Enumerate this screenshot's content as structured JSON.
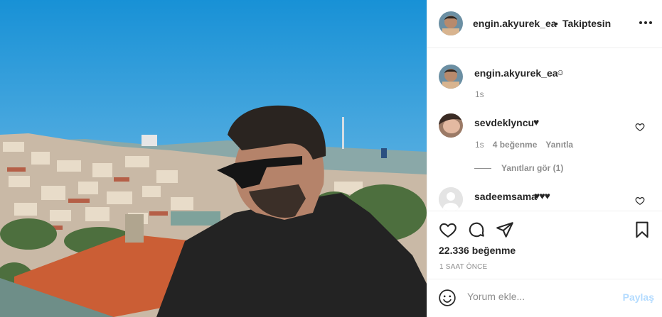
{
  "photo": {
    "alt_icon": "photo"
  },
  "header": {
    "username": "engin.akyurek_ea",
    "separator": "•",
    "follow_label": "Takiptesin",
    "more_icon": "more-horizontal-icon"
  },
  "caption": {
    "username": "engin.akyurek_ea",
    "text": "☺",
    "time": "1s"
  },
  "comments": [
    {
      "username": "sevdeklyncu",
      "text": "♥",
      "time": "1s",
      "likes": "4 beğenme",
      "reply_label": "Yanıtla",
      "view_replies": "Yanıtları gör (1)"
    },
    {
      "username": "sadeemsama",
      "text": "♥♥♥"
    }
  ],
  "actions": {
    "like_count": "22.336 beğenme",
    "time_ago": "1 SAAT ÖNCE"
  },
  "add_comment": {
    "placeholder": "Yorum ekle...",
    "post_label": "Paylaş"
  },
  "colors": {
    "text": "#262626",
    "secondary": "#8e8e8e",
    "border": "#efefef",
    "post_disabled": "#b3dbff"
  }
}
